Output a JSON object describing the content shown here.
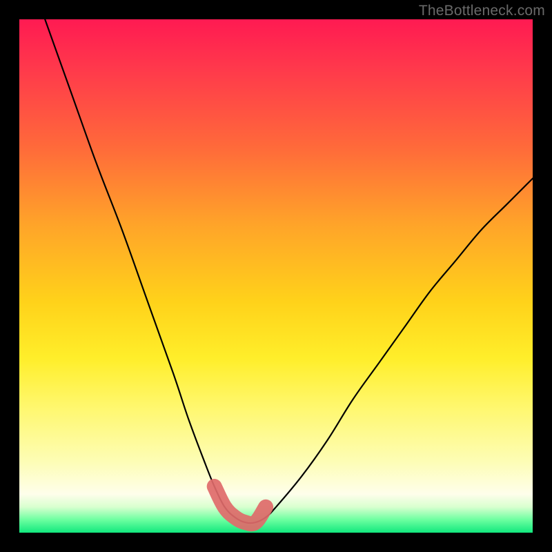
{
  "watermark": "TheBottleneck.com",
  "chart_data": {
    "type": "line",
    "title": "",
    "xlabel": "",
    "ylabel": "",
    "xlim": [
      0,
      100
    ],
    "ylim": [
      0,
      100
    ],
    "grid": false,
    "legend": false,
    "series": [
      {
        "name": "curve",
        "x": [
          5,
          10,
          15,
          20,
          25,
          30,
          33,
          36,
          38,
          40,
          42,
          44,
          46,
          48,
          50,
          55,
          60,
          65,
          70,
          75,
          80,
          85,
          90,
          95,
          100
        ],
        "y": [
          100,
          86,
          72,
          59,
          45,
          31,
          22,
          14,
          9,
          5,
          3,
          2,
          2,
          3,
          5,
          11,
          18,
          26,
          33,
          40,
          47,
          53,
          59,
          64,
          69
        ]
      }
    ],
    "highlight": {
      "name": "bottom-bracket",
      "x": [
        38,
        40,
        42,
        44,
        46,
        48
      ],
      "y": [
        9,
        5,
        3,
        2,
        2,
        5
      ]
    },
    "gradient_stops": [
      {
        "pos": 0.0,
        "color": "#ff1a52"
      },
      {
        "pos": 0.25,
        "color": "#ff6a3a"
      },
      {
        "pos": 0.55,
        "color": "#ffd21a"
      },
      {
        "pos": 0.86,
        "color": "#fdfdb4"
      },
      {
        "pos": 1.0,
        "color": "#11e87d"
      }
    ]
  }
}
